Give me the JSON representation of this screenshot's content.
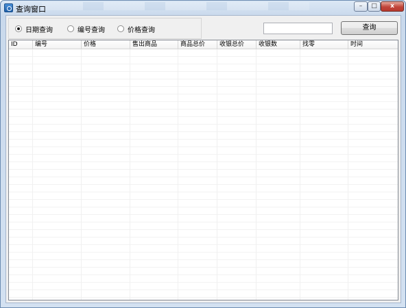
{
  "window": {
    "title": "查询窗口",
    "controls": {
      "minimize": "–",
      "maximize": "□",
      "close": "x"
    }
  },
  "filters": {
    "options": [
      {
        "label": "日期查询",
        "selected": true
      },
      {
        "label": "编号查询",
        "selected": false
      },
      {
        "label": "价格查询",
        "selected": false
      }
    ]
  },
  "search": {
    "value": "",
    "button_label": "查询"
  },
  "table": {
    "columns": [
      "ID",
      "编号",
      "价格",
      "售出商品",
      "商品总价",
      "收银总价",
      "收银数",
      "找零",
      "时间"
    ],
    "rows": []
  }
}
